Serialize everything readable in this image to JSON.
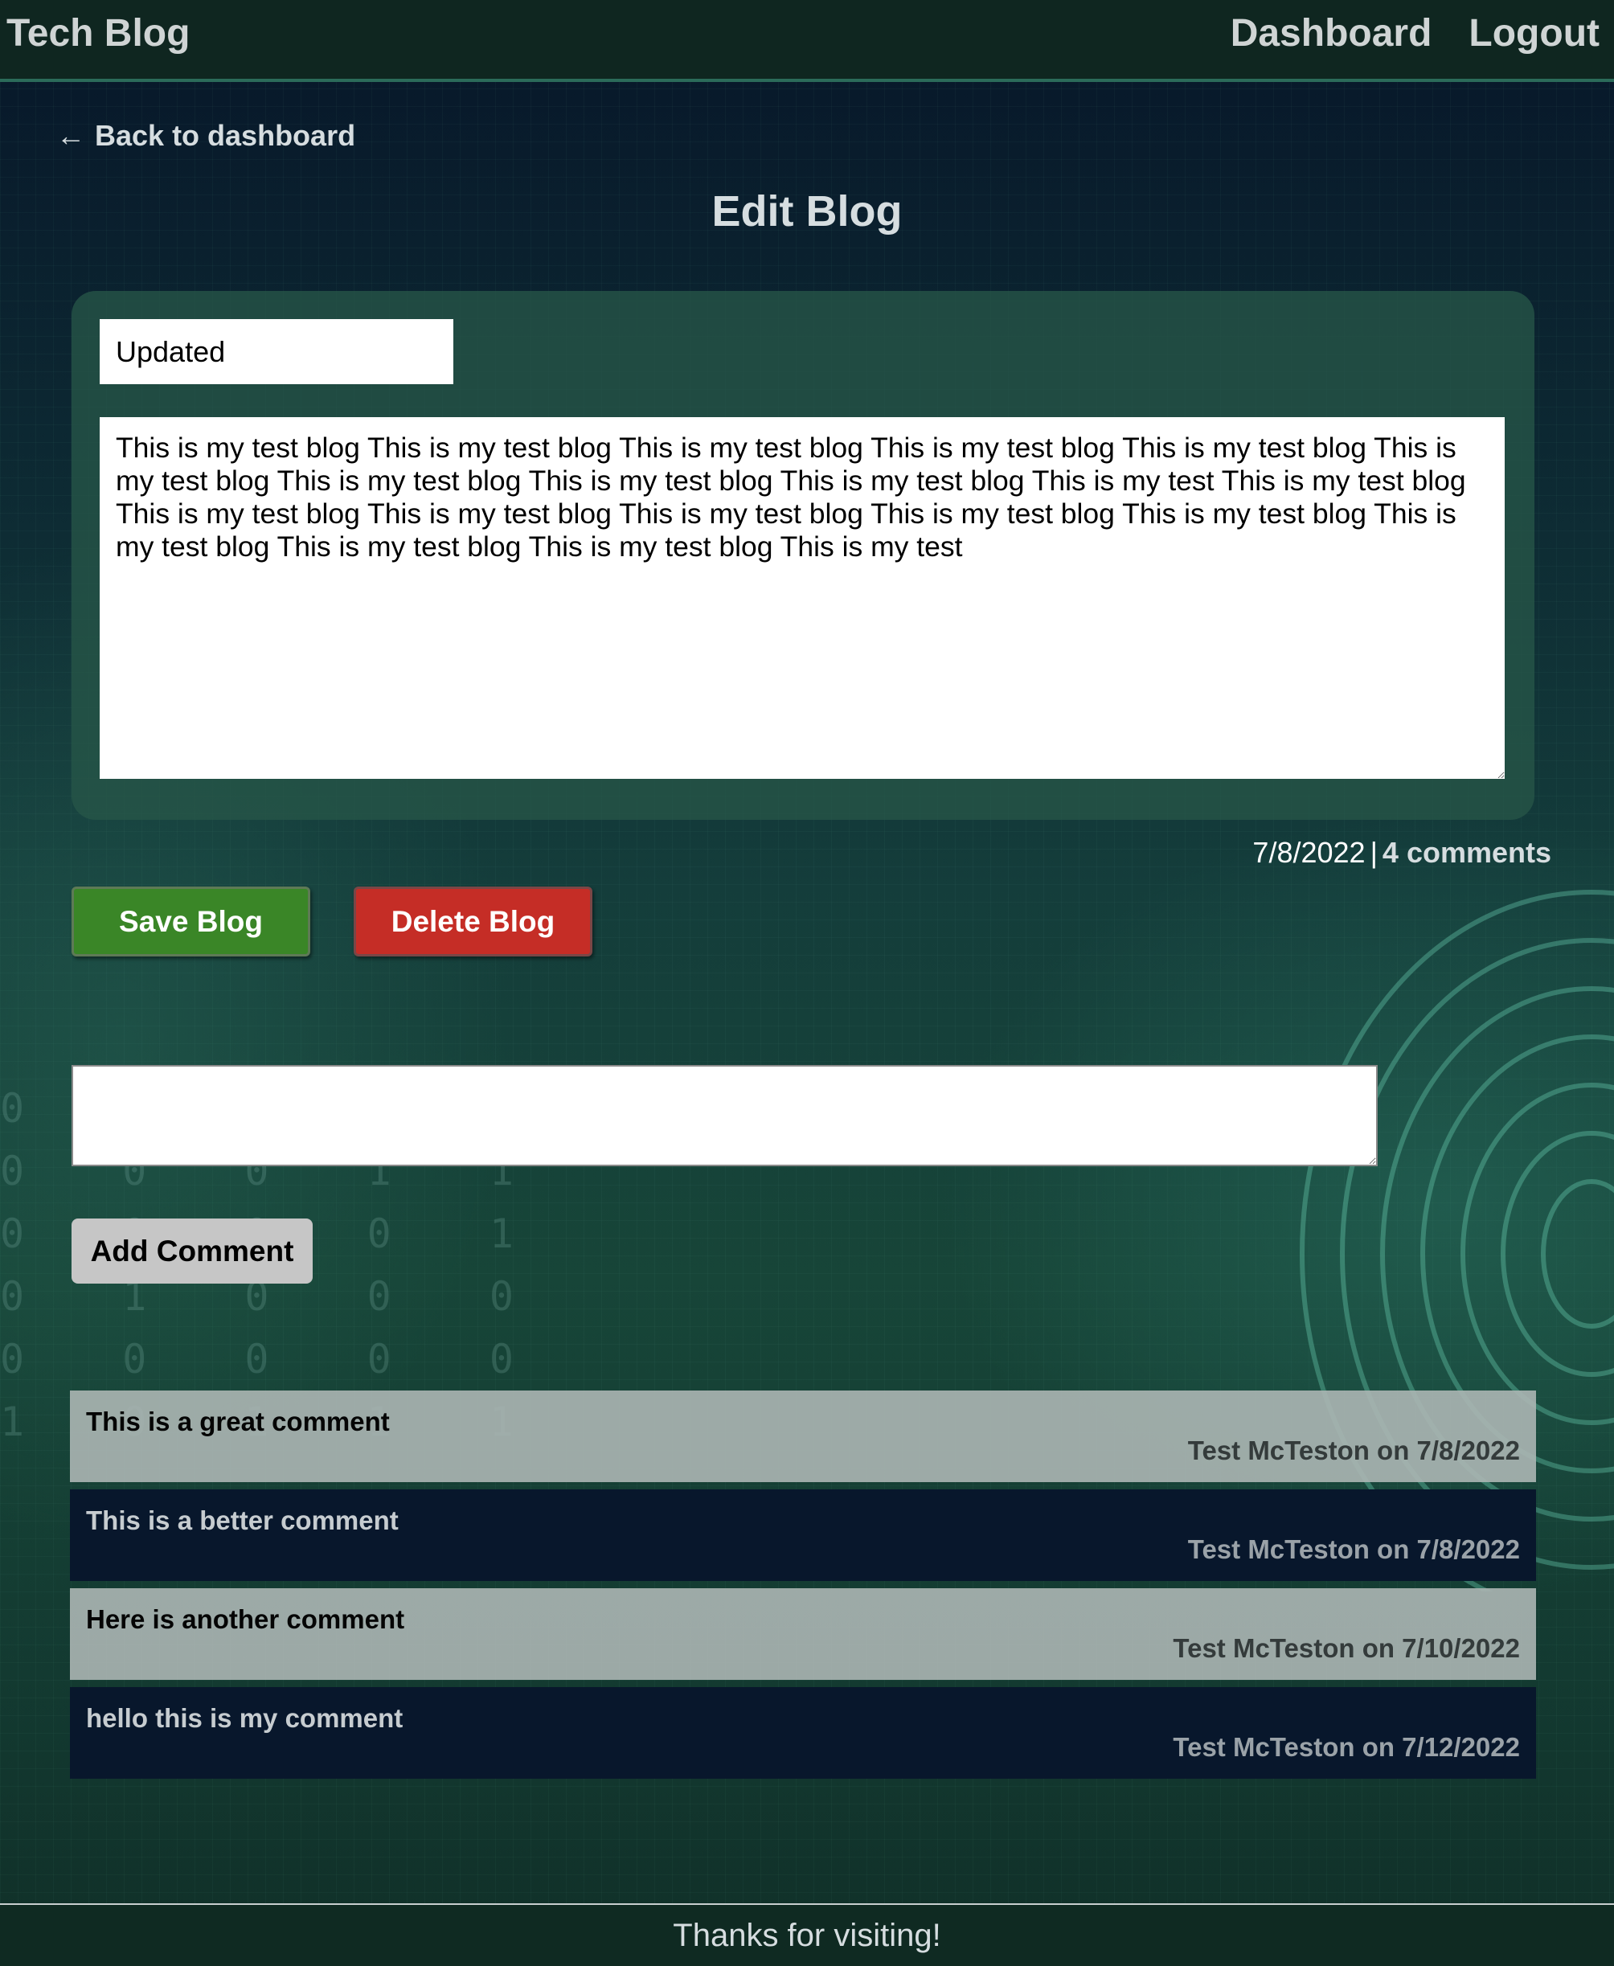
{
  "header": {
    "brand": "Tech Blog",
    "nav": {
      "dashboard": "Dashboard",
      "logout": "Logout"
    }
  },
  "back_link": {
    "arrow": "←",
    "label": "Back to dashboard"
  },
  "page_title": "Edit Blog",
  "post": {
    "title_value": "Updated",
    "body_value": "This is my test blog This is my test blog This is my test blog This is my test blog This is my test blog This is my test blog This is my test blog This is my test blog This is my test blog This is my test This is my test blog This is my test blog This is my test blog This is my test blog This is my test blog This is my test blog This is my test blog This is my test blog This is my test blog This is my test",
    "date": "7/8/2022",
    "separator": "|",
    "comment_count": "4 comments"
  },
  "buttons": {
    "save": "Save Blog",
    "delete": "Delete Blog",
    "add_comment": "Add Comment"
  },
  "comment_input": {
    "value": ""
  },
  "comments": [
    {
      "text": "This is a great comment",
      "byline": "Test McTeston on 7/8/2022"
    },
    {
      "text": "This is a better comment",
      "byline": "Test McTeston on 7/8/2022"
    },
    {
      "text": "Here is another comment",
      "byline": "Test McTeston on 7/10/2022"
    },
    {
      "text": "hello this is my comment",
      "byline": "Test McTeston on 7/12/2022"
    }
  ],
  "footer": {
    "text": "Thanks for visiting!"
  },
  "colors": {
    "save_button": "#3a8627",
    "delete_button": "#c52d26",
    "header_bg": "#0f2620",
    "card_bg": "#265648"
  }
}
